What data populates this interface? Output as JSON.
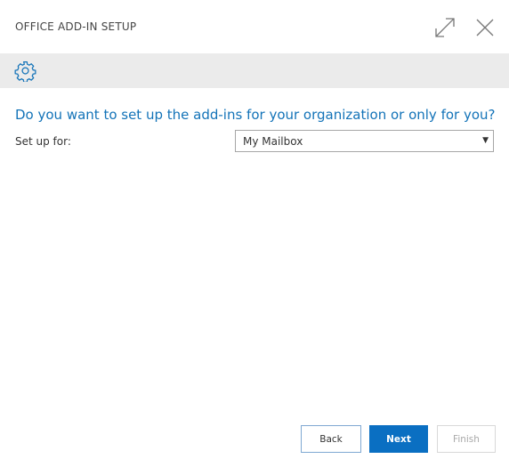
{
  "window": {
    "title": "OFFICE ADD-IN SETUP",
    "icons": [
      "expand-icon",
      "close-icon"
    ]
  },
  "toolbar": {
    "icon": "gear-icon",
    "colors": {
      "background": "#ebebeb",
      "icon": "#1373b8"
    }
  },
  "main": {
    "question": "Do you want to set up the add-ins for your organization or only for you?",
    "setup_for": {
      "label": "Set up for:",
      "selected_value": "My Mailbox"
    }
  },
  "buttons": {
    "back": "Back",
    "next": "Next",
    "finish": "Finish"
  },
  "colors": {
    "accent": "#0a6fc2",
    "question_text": "#1373b8"
  }
}
